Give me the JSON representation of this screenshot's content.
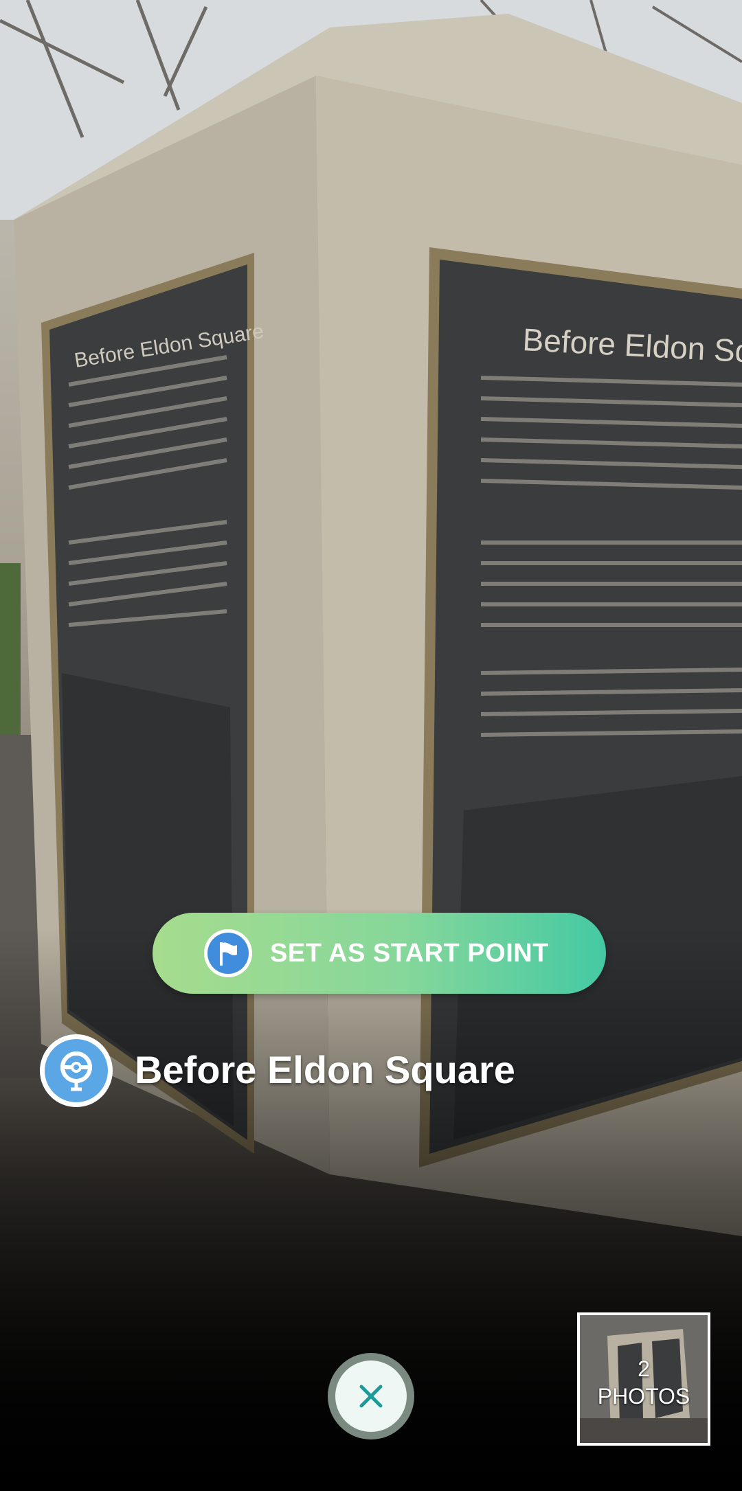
{
  "photo": {
    "plaque_left_title": "Before Eldon Square",
    "plaque_right_title": "Before Eldon Square"
  },
  "start_button": {
    "label": "SET AS START POINT"
  },
  "stop": {
    "name": "Before Eldon Square"
  },
  "photos": {
    "count": "2",
    "label": "PHOTOS"
  },
  "colors": {
    "accent_green": "#86d79a",
    "accent_teal": "#45c9a3",
    "flag_blue": "#3f8ddc",
    "close_teal": "#1e9a98"
  }
}
